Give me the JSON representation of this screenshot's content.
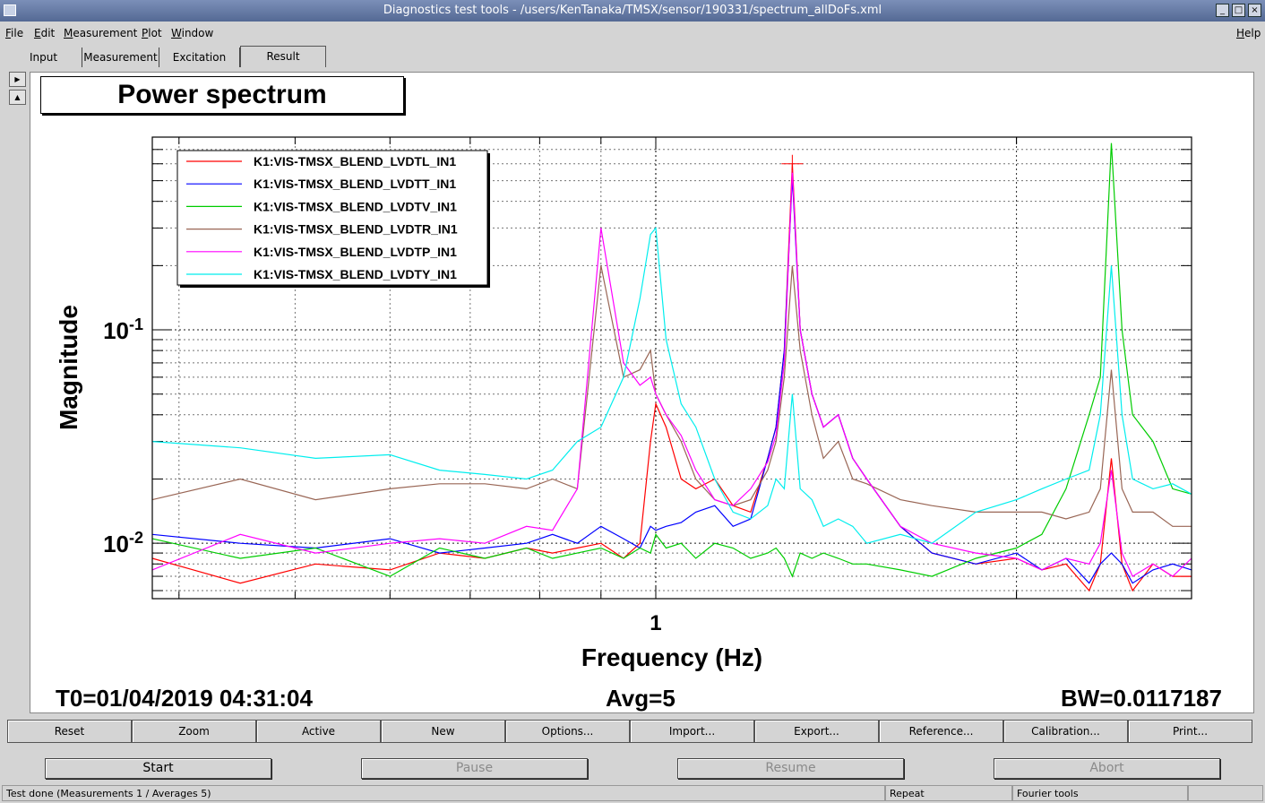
{
  "window": {
    "title": "Diagnostics test tools - /users/KenTanaka/TMSX/sensor/190331/spectrum_allDoFs.xml",
    "controls": [
      "_",
      "□",
      "×"
    ]
  },
  "menu": {
    "file": "File",
    "edit": "Edit",
    "measurement": "Measurement",
    "plot": "Plot",
    "window": "Window",
    "help": "Help"
  },
  "tabs": [
    {
      "label": "Input"
    },
    {
      "label": "Measurement"
    },
    {
      "label": "Excitation"
    },
    {
      "label": "Result",
      "active": true
    }
  ],
  "plot": {
    "title": "Power spectrum",
    "t0": "T0=01/04/2019 04:31:04",
    "avg": "Avg=5",
    "bw": "BW=0.0117187"
  },
  "chart_data": {
    "type": "line",
    "title": "Power spectrum",
    "xlabel": "Frequency (Hz)",
    "ylabel": "Magnitude",
    "x_scale": "log",
    "y_scale": "log",
    "xlim": [
      0.38,
      2.8
    ],
    "ylim": [
      0.0055,
      0.8
    ],
    "x_ticks": [
      {
        "value": 1,
        "label": "1"
      }
    ],
    "y_ticks": [
      {
        "value": 0.1,
        "base": "10",
        "exp": "-1"
      },
      {
        "value": 0.01,
        "base": "10",
        "exp": "-2"
      }
    ],
    "grid": true,
    "legend_position": "top-left",
    "x": [
      0.38,
      0.45,
      0.52,
      0.6,
      0.66,
      0.72,
      0.78,
      0.82,
      0.86,
      0.9,
      0.94,
      0.97,
      0.99,
      1.0,
      1.02,
      1.05,
      1.08,
      1.12,
      1.16,
      1.2,
      1.24,
      1.26,
      1.28,
      1.3,
      1.32,
      1.35,
      1.38,
      1.42,
      1.46,
      1.5,
      1.6,
      1.7,
      1.85,
      2.0,
      2.1,
      2.2,
      2.3,
      2.35,
      2.4,
      2.45,
      2.5,
      2.6,
      2.7,
      2.8
    ],
    "series": [
      {
        "name": "K1:VIS-TMSX_BLEND_LVDTL_IN1",
        "color": "#ff0000",
        "values": [
          0.0085,
          0.0065,
          0.008,
          0.0075,
          0.009,
          0.0085,
          0.0095,
          0.009,
          0.0095,
          0.01,
          0.0085,
          0.01,
          0.03,
          0.045,
          0.035,
          0.02,
          0.018,
          0.02,
          0.015,
          0.014,
          0.025,
          0.035,
          0.08,
          0.6,
          0.1,
          0.05,
          0.035,
          0.04,
          0.025,
          0.02,
          0.012,
          0.009,
          0.008,
          0.0085,
          0.0075,
          0.008,
          0.006,
          0.008,
          0.025,
          0.008,
          0.006,
          0.008,
          0.007,
          0.007
        ]
      },
      {
        "name": "K1:VIS-TMSX_BLEND_LVDTT_IN1",
        "color": "#0000ff",
        "values": [
          0.011,
          0.01,
          0.0095,
          0.0105,
          0.009,
          0.0095,
          0.01,
          0.011,
          0.01,
          0.012,
          0.0105,
          0.0095,
          0.012,
          0.0115,
          0.012,
          0.0125,
          0.014,
          0.015,
          0.012,
          0.013,
          0.025,
          0.035,
          0.08,
          0.52,
          0.1,
          0.05,
          0.035,
          0.04,
          0.025,
          0.02,
          0.012,
          0.009,
          0.008,
          0.009,
          0.0075,
          0.0085,
          0.0065,
          0.008,
          0.009,
          0.008,
          0.0065,
          0.0075,
          0.008,
          0.0075
        ]
      },
      {
        "name": "K1:VIS-TMSX_BLEND_LVDTV_IN1",
        "color": "#00cc00",
        "values": [
          0.0105,
          0.0085,
          0.0095,
          0.007,
          0.0095,
          0.0085,
          0.0095,
          0.0085,
          0.009,
          0.0095,
          0.0085,
          0.0095,
          0.009,
          0.011,
          0.0095,
          0.01,
          0.0085,
          0.01,
          0.0095,
          0.0085,
          0.009,
          0.0095,
          0.0085,
          0.007,
          0.009,
          0.0085,
          0.009,
          0.0085,
          0.008,
          0.008,
          0.0075,
          0.007,
          0.0085,
          0.0095,
          0.011,
          0.018,
          0.04,
          0.06,
          0.75,
          0.1,
          0.04,
          0.03,
          0.018,
          0.017
        ]
      },
      {
        "name": "K1:VIS-TMSX_BLEND_LVDTR_IN1",
        "color": "#996655",
        "values": [
          0.016,
          0.02,
          0.016,
          0.018,
          0.019,
          0.019,
          0.018,
          0.02,
          0.018,
          0.2,
          0.06,
          0.065,
          0.08,
          0.05,
          0.04,
          0.03,
          0.02,
          0.016,
          0.015,
          0.016,
          0.022,
          0.03,
          0.06,
          0.2,
          0.08,
          0.04,
          0.025,
          0.03,
          0.02,
          0.019,
          0.016,
          0.015,
          0.014,
          0.014,
          0.014,
          0.013,
          0.014,
          0.018,
          0.065,
          0.018,
          0.014,
          0.014,
          0.012,
          0.012
        ]
      },
      {
        "name": "K1:VIS-TMSX_BLEND_LVDTP_IN1",
        "color": "#ff00ff",
        "values": [
          0.0075,
          0.011,
          0.009,
          0.01,
          0.0105,
          0.01,
          0.012,
          0.0115,
          0.018,
          0.3,
          0.07,
          0.055,
          0.06,
          0.05,
          0.04,
          0.032,
          0.022,
          0.016,
          0.015,
          0.018,
          0.024,
          0.032,
          0.07,
          0.56,
          0.1,
          0.05,
          0.035,
          0.04,
          0.025,
          0.02,
          0.012,
          0.01,
          0.009,
          0.0085,
          0.0075,
          0.0085,
          0.008,
          0.01,
          0.022,
          0.009,
          0.007,
          0.008,
          0.007,
          0.0085
        ]
      },
      {
        "name": "K1:VIS-TMSX_BLEND_LVDTY_IN1",
        "color": "#00eeee",
        "values": [
          0.03,
          0.028,
          0.025,
          0.026,
          0.022,
          0.021,
          0.02,
          0.022,
          0.03,
          0.035,
          0.06,
          0.14,
          0.28,
          0.3,
          0.09,
          0.045,
          0.035,
          0.02,
          0.014,
          0.013,
          0.015,
          0.02,
          0.018,
          0.05,
          0.018,
          0.016,
          0.012,
          0.013,
          0.012,
          0.01,
          0.011,
          0.01,
          0.014,
          0.016,
          0.018,
          0.02,
          0.022,
          0.04,
          0.2,
          0.04,
          0.02,
          0.018,
          0.019,
          0.017
        ]
      }
    ]
  },
  "toolbar": [
    "Reset",
    "Zoom",
    "Active",
    "New",
    "Options...",
    "Import...",
    "Export...",
    "Reference...",
    "Calibration...",
    "Print..."
  ],
  "controls": {
    "start": "Start",
    "pause": "Pause",
    "resume": "Resume",
    "abort": "Abort"
  },
  "status": {
    "message": "Test done (Measurements 1 / Averages 5)",
    "mode": "Repeat",
    "tool": "Fourier tools"
  }
}
